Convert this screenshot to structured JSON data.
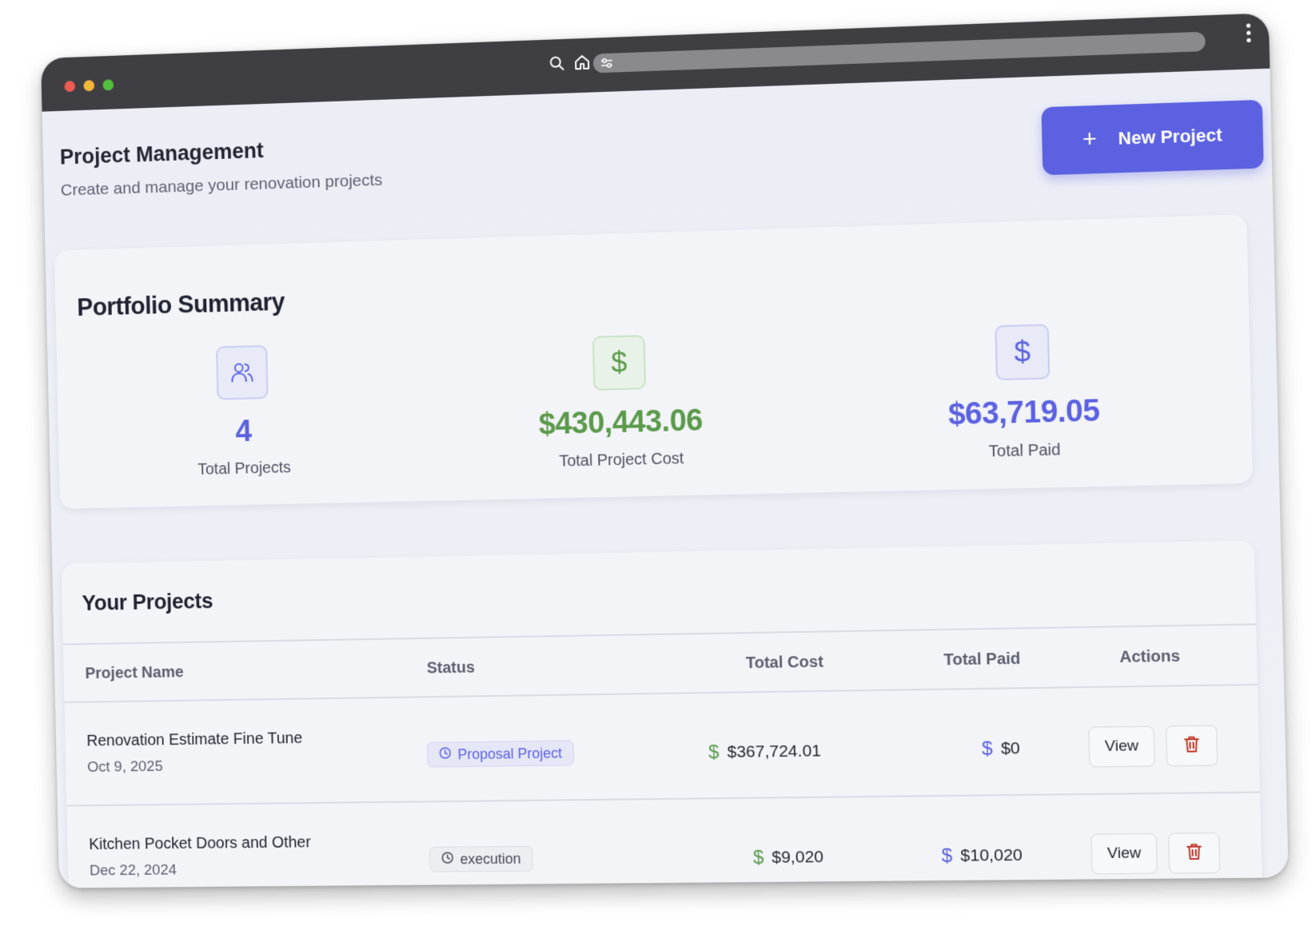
{
  "browser": {
    "icons": [
      "search-icon",
      "home-icon",
      "tune-icon",
      "more-vertical-icon"
    ]
  },
  "header": {
    "title": "Project Management",
    "subtitle": "Create and manage your renovation projects",
    "new_project_icon": "+",
    "new_project_label": "New Project"
  },
  "summary": {
    "title": "Portfolio Summary",
    "stats": [
      {
        "icon": "users-icon",
        "value": "4",
        "caption": "Total Projects",
        "color": "#5b61e0"
      },
      {
        "icon": "dollar-icon",
        "icon_text": "$",
        "value": "$430,443.06",
        "caption": "Total Project Cost",
        "color": "#5a9a4a"
      },
      {
        "icon": "dollar-icon",
        "icon_text": "$",
        "value": "$63,719.05",
        "caption": "Total Paid",
        "color": "#5b61e0"
      }
    ]
  },
  "projects": {
    "title": "Your Projects",
    "columns": [
      "Project Name",
      "Status",
      "Total Cost",
      "Total Paid",
      "Actions"
    ],
    "rows": [
      {
        "name": "Renovation Estimate Fine Tune",
        "date": "Oct 9, 2025",
        "status": "Proposal Project",
        "cost_sign": "$",
        "cost": "$367,724.01",
        "paid_sign": "$",
        "paid": "$0",
        "view_label": "View"
      },
      {
        "name": "Kitchen Pocket Doors and Other",
        "date": "Dec 22, 2024",
        "status": "execution",
        "cost_sign": "$",
        "cost": "$9,020",
        "paid_sign": "$",
        "paid": "$10,020",
        "view_label": "View"
      }
    ]
  },
  "colors": {
    "accent": "#5b61e0",
    "money_green": "#5a9a4a",
    "delete_red": "#c0392b",
    "titlebar": "#3f3f43"
  }
}
